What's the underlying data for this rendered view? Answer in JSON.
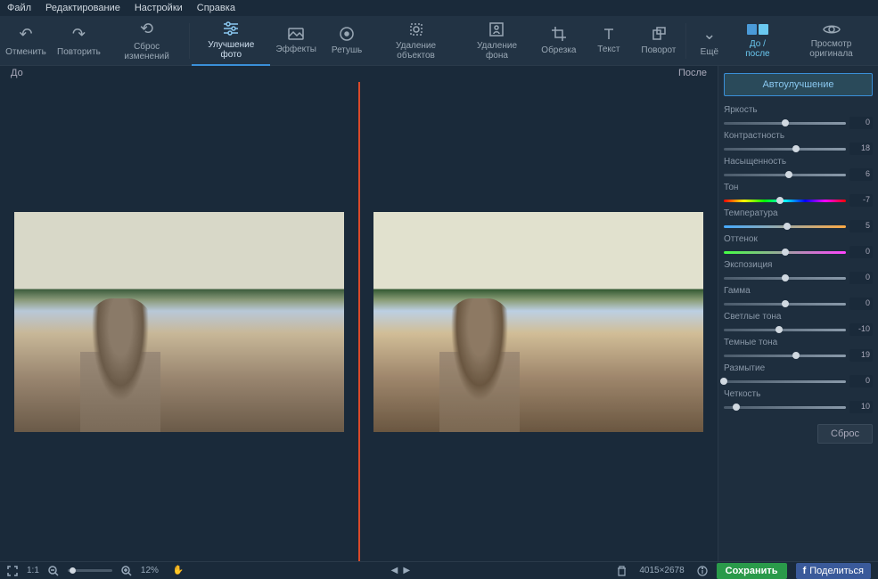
{
  "menu": {
    "file": "Файл",
    "edit": "Редактирование",
    "settings": "Настройки",
    "help": "Справка"
  },
  "toolbar": {
    "undo": "Отменить",
    "redo": "Повторить",
    "reset": "Сброс изменений",
    "enhance": "Улучшение фото",
    "effects": "Эффекты",
    "retouch": "Ретушь",
    "remove_obj": "Удаление объектов",
    "remove_bg": "Удаление фона",
    "crop": "Обрезка",
    "text": "Текст",
    "rotate": "Поворот",
    "more": "Ещё",
    "before_after": "До / после",
    "view_original": "Просмотр оригинала"
  },
  "canvas": {
    "before": "До",
    "after": "После"
  },
  "sidebar": {
    "auto": "Автоулучшение",
    "reset": "Сброс",
    "sliders": [
      {
        "label": "Яркость",
        "value": 0,
        "pos": 50,
        "type": "plain"
      },
      {
        "label": "Контрастность",
        "value": 18,
        "pos": 59,
        "type": "plain"
      },
      {
        "label": "Насыщенность",
        "value": 6,
        "pos": 53,
        "type": "plain"
      },
      {
        "label": "Тон",
        "value": -7,
        "pos": 46,
        "type": "hue"
      },
      {
        "label": "Температура",
        "value": 5,
        "pos": 52,
        "type": "temp"
      },
      {
        "label": "Оттенок",
        "value": 0,
        "pos": 50,
        "type": "tint"
      },
      {
        "label": "Экспозиция",
        "value": 0,
        "pos": 50,
        "type": "plain"
      },
      {
        "label": "Гамма",
        "value": 0,
        "pos": 50,
        "type": "plain"
      },
      {
        "label": "Светлые тона",
        "value": -10,
        "pos": 45,
        "type": "plain"
      },
      {
        "label": "Темные тона",
        "value": 19,
        "pos": 59,
        "type": "plain"
      },
      {
        "label": "Размытие",
        "value": 0,
        "pos": 0,
        "type": "plain"
      },
      {
        "label": "Четкость",
        "value": 10,
        "pos": 10,
        "type": "plain"
      }
    ]
  },
  "bottom": {
    "fit": "1:1",
    "zoom_pct": "12%",
    "dimensions": "4015×2678",
    "save": "Сохранить",
    "share": "Поделиться"
  }
}
